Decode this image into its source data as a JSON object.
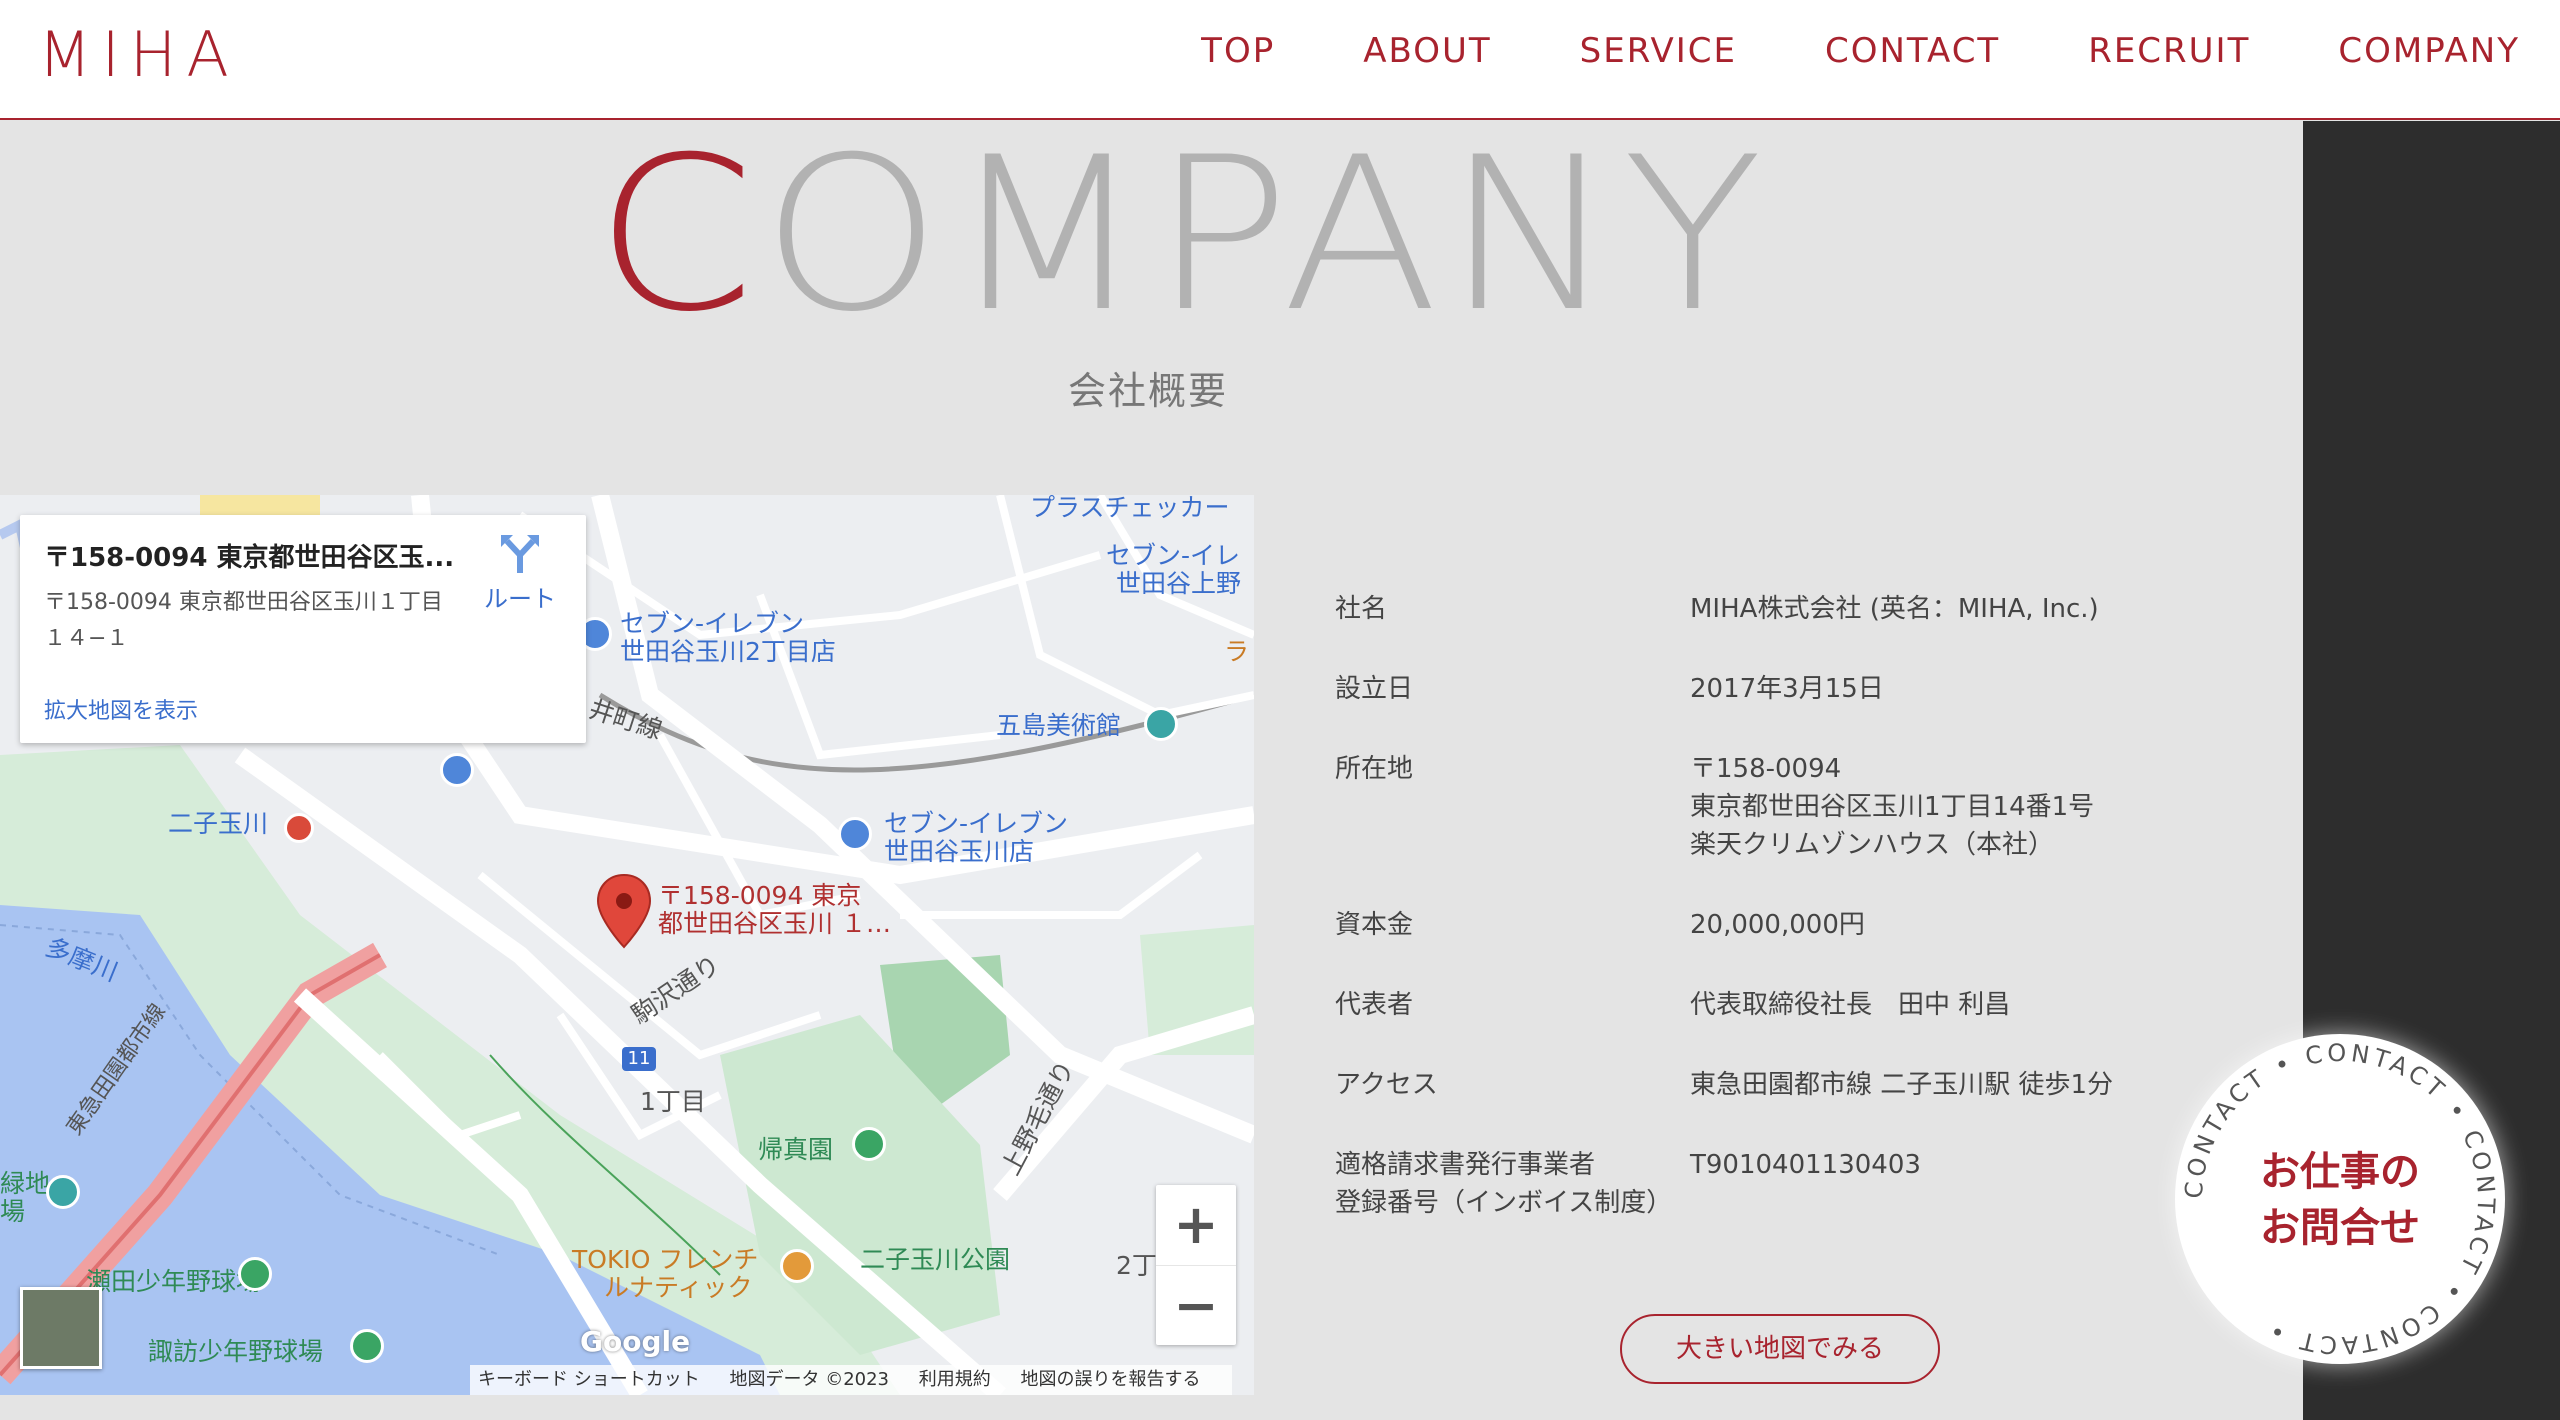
{
  "header": {
    "logo": "MIHA",
    "nav": [
      "TOP",
      "ABOUT",
      "SERVICE",
      "CONTACT",
      "RECRUIT",
      "COMPANY"
    ]
  },
  "title": {
    "first_letter": "C",
    "rest": "OMPANY",
    "subtitle": "会社概要"
  },
  "map": {
    "card_title": "〒158-0094 東京都世田谷区玉...",
    "card_address": "〒158-0094 東京都世田谷区玉川１丁目１４−１",
    "card_link": "拡大地図を表示",
    "route_label": "ルート",
    "labels": {
      "plus_checker": "プラスチェッカー",
      "seven_ueno_1": "セブン-イレ",
      "seven_ueno_2": "世田谷上野",
      "seven_tamagawa2_1": "セブン-イレブン",
      "seven_tamagawa2_2": "世田谷玉川2丁目店",
      "seven_tamagawa_1": "セブン-イレブン",
      "seven_tamagawa_2": "世田谷玉川店",
      "goto_museum": "五島美術館",
      "futako_station": "二子玉川",
      "oimachi_line": "井町線",
      "tamagawa_river": "多摩川",
      "denentoshi_line": "東急田園都市線",
      "pin_1": "〒158-0094 東京",
      "pin_2": "都世田谷区玉川 １…",
      "komazawa": "駒沢通り",
      "route_11": "11",
      "itchome": "1丁目",
      "kishinen": "帰真園",
      "uenoge": "上野毛通り",
      "futako_park": "二子玉川公園",
      "nichome": "2丁",
      "tokio_1": "TOKIO フレンチ",
      "tokio_2": "ルナティック",
      "seta_baseball": "瀬田少年野球場",
      "suwa_baseball": "諏訪少年野球場",
      "ryokuchi_1": "緑地",
      "ryokuchi_2": "場",
      "ra": "ラ"
    },
    "zoom_in": "+",
    "zoom_out": "−",
    "google": "Google",
    "attribution": [
      "キーボード ショートカット",
      "地図データ ©2023",
      "利用規約",
      "地図の誤りを報告する"
    ]
  },
  "company": {
    "rows": [
      {
        "key": [
          "社名"
        ],
        "value": [
          "MIHA株式会社 (英名：MIHA, Inc.)"
        ]
      },
      {
        "key": [
          "設立日"
        ],
        "value": [
          "2017年3月15日"
        ]
      },
      {
        "key": [
          "所在地"
        ],
        "value": [
          "〒158-0094",
          "東京都世田谷区玉川1丁目14番1号",
          "楽天クリムゾンハウス（本社）"
        ]
      },
      {
        "key": [
          "資本金"
        ],
        "value": [
          "20,000,000円"
        ]
      },
      {
        "key": [
          "代表者"
        ],
        "value": [
          "代表取締役社長　田中 利昌"
        ]
      },
      {
        "key": [
          "アクセス"
        ],
        "value": [
          "東急田園都市線 二子玉川駅 徒歩1分"
        ]
      },
      {
        "key": [
          "適格請求書発行事業者",
          "登録番号（インボイス制度）"
        ],
        "value": [
          "T9010401130403"
        ]
      }
    ],
    "map_button": "大きい地図でみる"
  },
  "contact_badge": {
    "line1": "お仕事の",
    "line2": "お問合せ",
    "ring_text": "CONTACT • CONTACT • CONTACT • CONTACT • "
  },
  "colors": {
    "accent": "#a8232e",
    "title_gray": "#b2b2b2",
    "background": "#e4e4e4",
    "dark_strip": "#2d2d2d"
  }
}
